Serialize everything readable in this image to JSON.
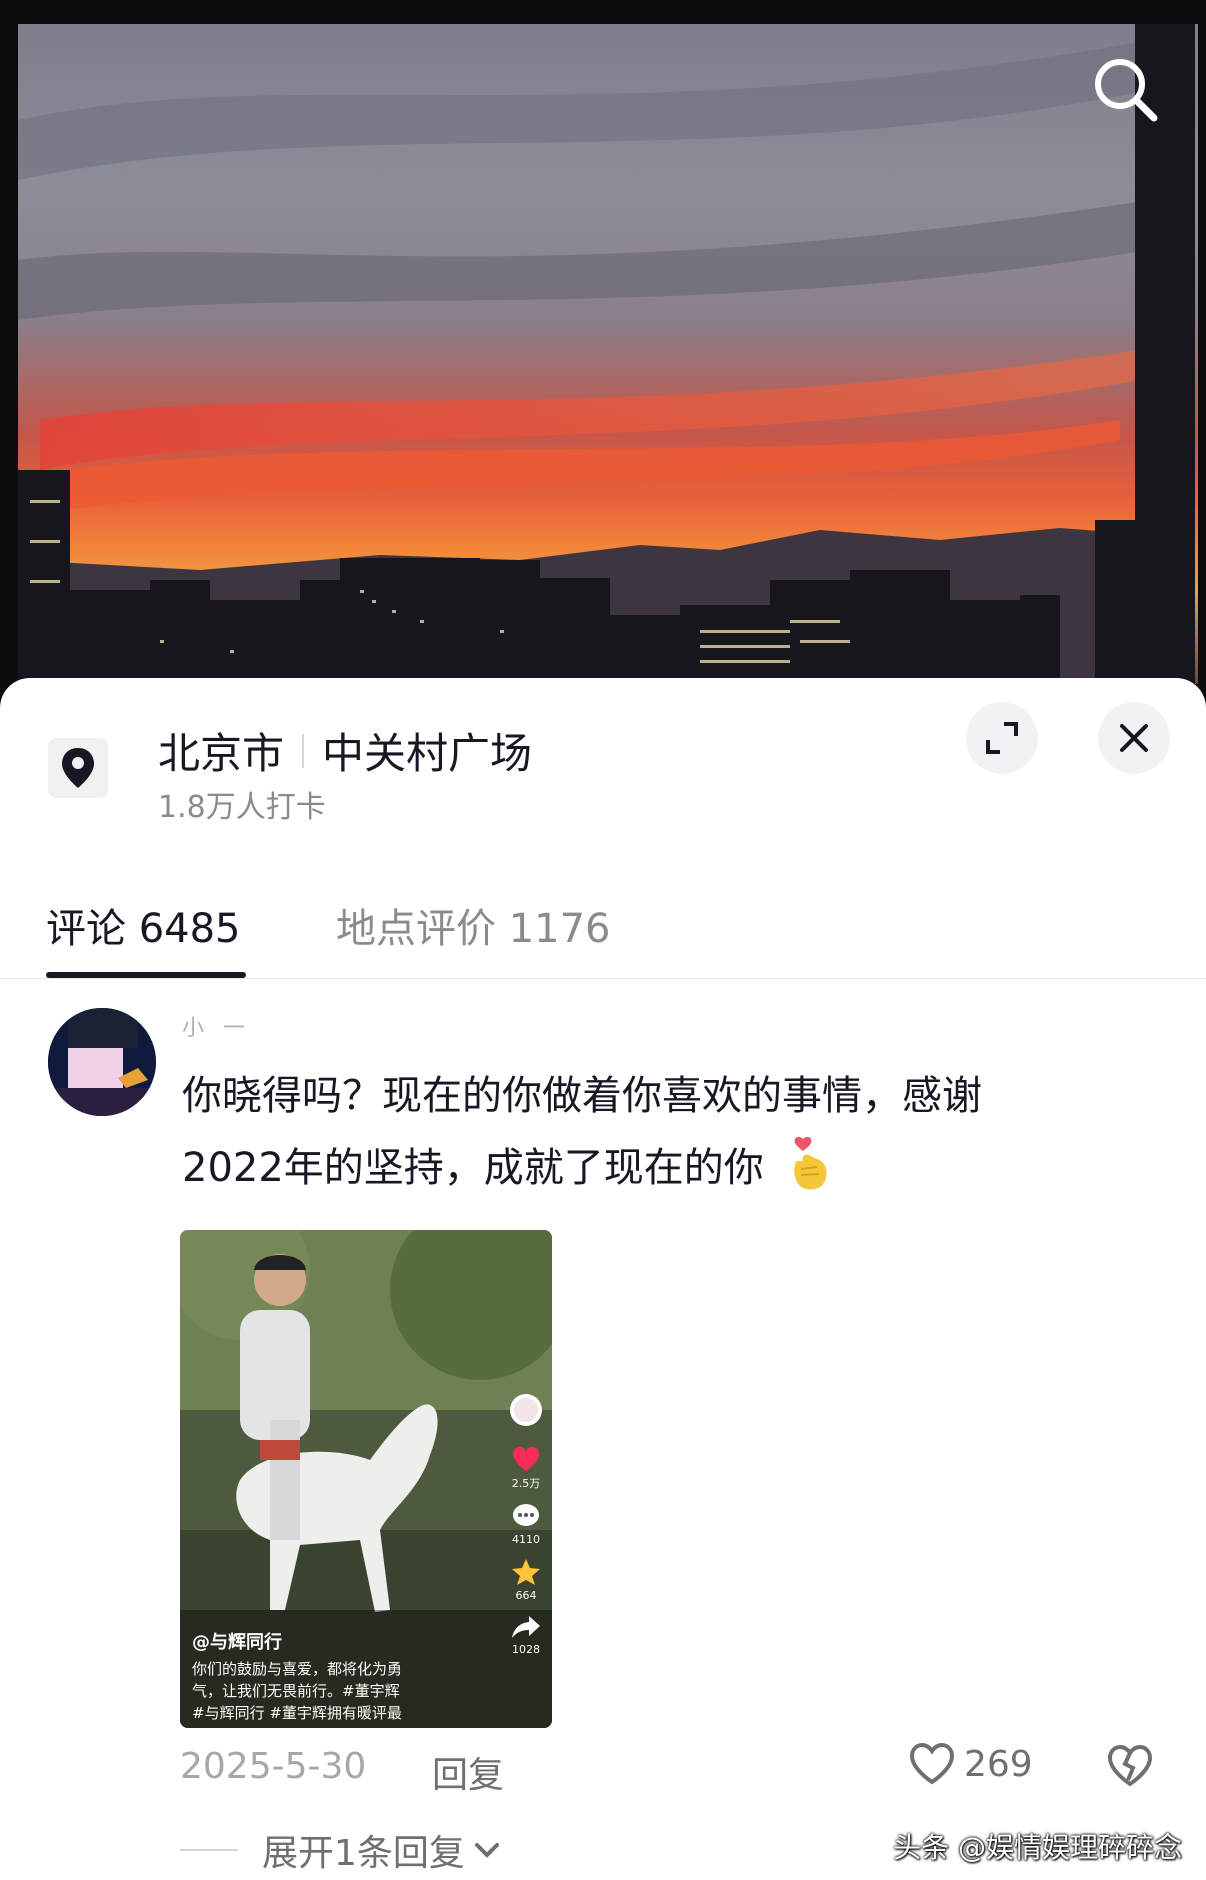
{
  "header": {
    "search_icon": "search-icon"
  },
  "location": {
    "city": "北京市",
    "place": "中关村广场",
    "checkins": "1.8万人打卡",
    "pin_icon": "location-pin-icon",
    "expand_icon": "expand-icon",
    "close_icon": "close-icon"
  },
  "tabs": [
    {
      "label": "评论 6485",
      "active": true
    },
    {
      "label": "地点评价 1176",
      "active": false
    }
  ],
  "comment": {
    "username": "小  一",
    "text_line1": "你晓得吗？现在的你做着你喜欢的事情，感谢",
    "text_line2": "2022年的坚持，成就了现在的你",
    "emoji_icon": "finger-heart-icon",
    "date": "2025-5-30",
    "reply_label": "回复",
    "like_count": "269",
    "like_icon": "heart-outline-icon",
    "dislike_icon": "broken-heart-icon",
    "expand_label": "展开1条回复",
    "video": {
      "author": "@与辉同行",
      "desc_line1": "你们的鼓励与喜爱，都将化为勇",
      "desc_line2": "气，让我们无畏前行。#董宇辉",
      "desc_line3": "#与辉同行 #董宇辉拥有暖评最",
      "likes": "2.5万",
      "comments": "4110",
      "favorites": "664",
      "shares": "1028",
      "avatar_text": "与辉同行"
    }
  },
  "watermark": "头条 @娱情娱理碎碎念"
}
